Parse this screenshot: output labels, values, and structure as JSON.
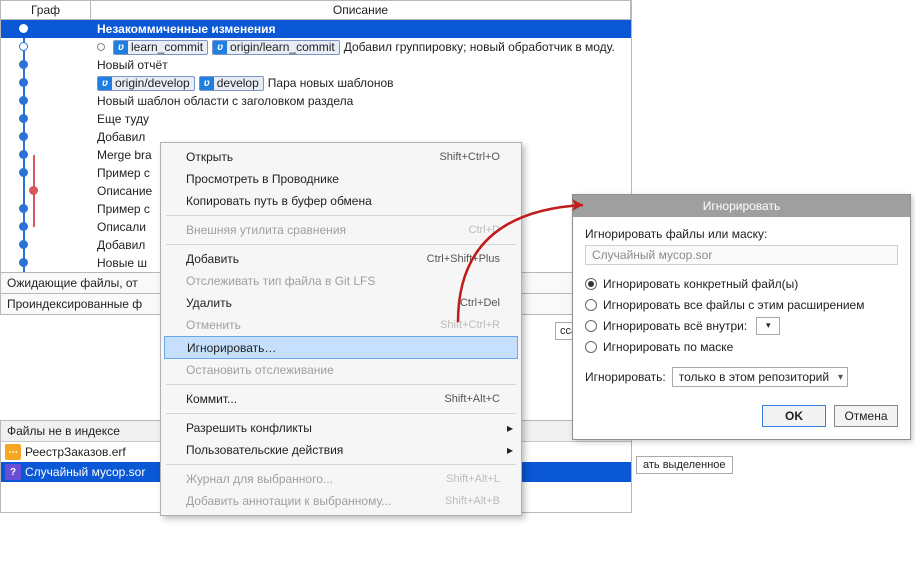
{
  "headers": {
    "graph": "Граф",
    "desc": "Описание"
  },
  "commits": {
    "r0": "Незакоммиченные изменения",
    "b1a": "learn_commit",
    "b1b": "origin/learn_commit",
    "r1": "Добавил группировку; новый обработчик в моду.",
    "r2": "Новый отчёт",
    "b3a": "origin/develop",
    "b3b": "develop",
    "r3": "Пара новых шаблонов",
    "r4": "Новый шаблон области с заголовком раздела",
    "r5": "Еще туду",
    "r6": "Добавил",
    "r7": "Merge bra",
    "r8": "Пример с",
    "r9": "Описание",
    "r10": "Пример с",
    "r11": "Описали",
    "r12": "Добавил",
    "r13": "Новые ш"
  },
  "pending_bar": "Ожидающие файлы, от",
  "staged_bar": "Проиндексированные ф",
  "unstaged_header": "Файлы не в индексе",
  "files": {
    "f1": "РеестрЗаказов.erf",
    "f2": "Случайный мусор.sor"
  },
  "stage_trailing1": "сса выд",
  "stage_trailing2": "ать выделенное",
  "ctx": {
    "open": "Открыть",
    "open_a": "Shift+Ctrl+O",
    "explorer": "Просмотреть в Проводнике",
    "copy_path": "Копировать путь в буфер обмена",
    "ext_diff": "Внешняя утилита сравнения",
    "ext_diff_a": "Ctrl+D",
    "add": "Добавить",
    "add_a": "Ctrl+Shift+Plus",
    "lfs": "Отслеживать тип файла в Git LFS",
    "del": "Удалить",
    "del_a": "Ctrl+Del",
    "revert": "Отменить",
    "revert_a": "Shift+Ctrl+R",
    "ignore": "Игнорировать…",
    "untrack": "Остановить отслеживание",
    "commit": "Коммит...",
    "commit_a": "Shift+Alt+C",
    "resolve": "Разрешить конфликты",
    "custom": "Пользовательские действия",
    "log": "Журнал для выбранного...",
    "log_a": "Shift+Alt+L",
    "blame": "Добавить аннотации к выбранному...",
    "blame_a": "Shift+Alt+B"
  },
  "dlg": {
    "title": "Игнорировать",
    "label": "Игнорировать файлы или маску:",
    "input": "Случайный мусор.sor",
    "opt1": "Игнорировать конкретный файл(ы)",
    "opt2": "Игнорировать все файлы с этим расширением",
    "opt3": "Игнорировать всё внутри:",
    "opt4": "Игнорировать по маске",
    "where_label": "Игнорировать:",
    "where_value": "только в этом репозиторий",
    "ok": "OK",
    "cancel": "Отмена"
  }
}
